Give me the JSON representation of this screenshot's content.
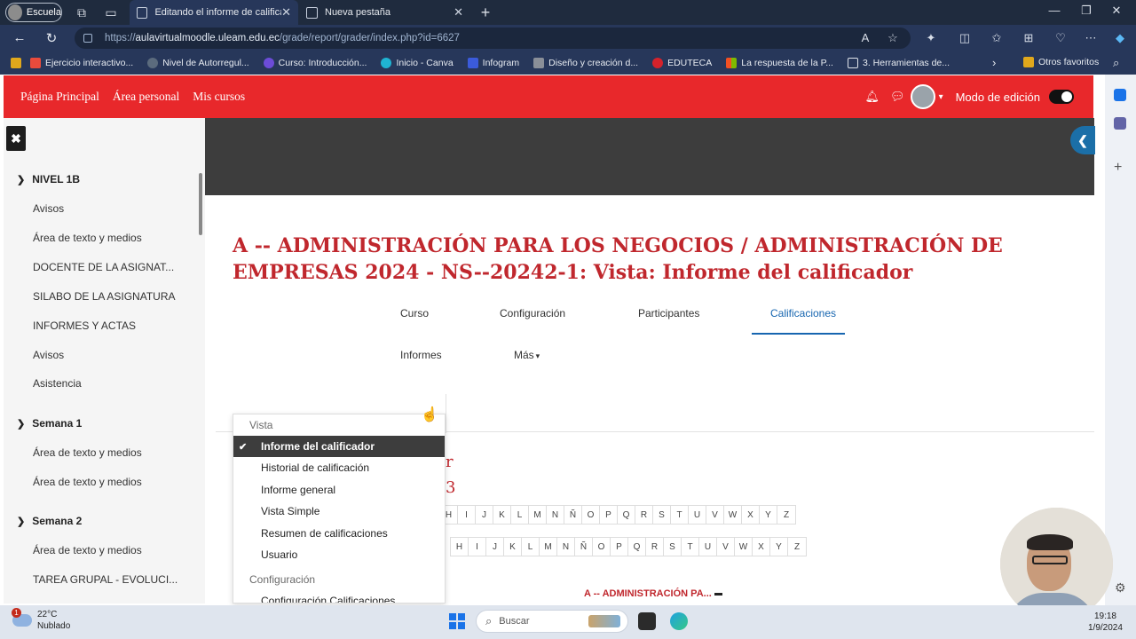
{
  "browser": {
    "profile_label": "Escuela",
    "tabs": [
      {
        "label": "Editando el informe de calificacio"
      },
      {
        "label": "Nueva pestaña"
      }
    ],
    "url_prefix": "https://",
    "url_domain": "aulavirtualmoodle.uleam.edu.ec",
    "url_path": "/grade/report/grader/index.php?id=6627",
    "bookmarks": [
      {
        "label": "Ejercicio interactivo...",
        "color": "#e94b3c"
      },
      {
        "label": "Nivel de Autorregul...",
        "color": "#5b6b7d"
      },
      {
        "label": "Curso: Introducción...",
        "color": "#6c4cd8"
      },
      {
        "label": "Inicio - Canva",
        "color": "#1fb4d2"
      },
      {
        "label": "Infogram",
        "color": "#3b5bdb"
      },
      {
        "label": "Diseño y creación d...",
        "color": "#8a8f98"
      },
      {
        "label": "EDUTECA",
        "color": "#d6222b"
      },
      {
        "label": "La respuesta de la P...",
        "color": "#3c9d3c"
      },
      {
        "label": "3. Herramientas de...",
        "color": "#dfe3ea"
      }
    ],
    "other_favorites": "Otros favoritos"
  },
  "moodle": {
    "nav": [
      "Página Principal",
      "Área personal",
      "Mis cursos"
    ],
    "edit_mode_label": "Modo de edición",
    "sidebar": {
      "sections": [
        {
          "title": "NIVEL 1B",
          "items": [
            "Avisos",
            "Área de texto y medios",
            "DOCENTE DE LA ASIGNAT...",
            "SILABO DE LA ASIGNATURA",
            "INFORMES Y ACTAS",
            "Avisos",
            "Asistencia"
          ]
        },
        {
          "title": "Semana 1",
          "items": [
            "Área de texto y medios",
            "Área de texto y medios"
          ]
        },
        {
          "title": "Semana 2",
          "items": [
            "Área de texto y medios",
            "TAREA GRUPAL - EVOLUCI..."
          ]
        }
      ]
    },
    "page_title": "A -- ADMINISTRACIÓN PARA LOS NEGOCIOS / ADMINISTRACIÓN DE EMPRESAS 2024 - NS--20242-1: Vista: Informe del calificador",
    "secondary_nav": {
      "curso": "Curso",
      "configuracion": "Configuración",
      "participantes": "Participantes",
      "calificaciones": "Calificaciones",
      "informes": "Informes",
      "mas": "Más"
    },
    "dropdown": {
      "group1_header": "Vista",
      "group1_items": [
        "Informe del calificador",
        "Historial de calificación",
        "Informe general",
        "Vista Simple",
        "Resumen de calificaciones",
        "Usuario"
      ],
      "group2_header": "Configuración",
      "group2_items": [
        "Configuración Calificaciones"
      ]
    },
    "partial_heading_1": "r",
    "partial_heading_2": "3",
    "letters_row1": [
      "H",
      "I",
      "J",
      "K",
      "L",
      "M",
      "N",
      "Ñ",
      "O",
      "P",
      "Q",
      "R",
      "S",
      "T",
      "U",
      "V",
      "W",
      "X",
      "Y",
      "Z"
    ],
    "letters_row2": [
      "H",
      "I",
      "J",
      "K",
      "L",
      "M",
      "N",
      "Ñ",
      "O",
      "P",
      "Q",
      "R",
      "S",
      "T",
      "U",
      "V",
      "W",
      "X",
      "Y",
      "Z"
    ],
    "grade_column_header": "A -- ADMINISTRACIÓN PA...",
    "grade_column_icon": "collapse-icon"
  },
  "taskbar": {
    "temperature": "22°C",
    "weather": "Nublado",
    "notification_count": "1",
    "search_placeholder": "Buscar",
    "time": "19:18",
    "date": "1/9/2024"
  },
  "colors": {
    "moodle_red": "#e8282b",
    "title_red": "#c0272d",
    "link_blue": "#1766b0"
  }
}
